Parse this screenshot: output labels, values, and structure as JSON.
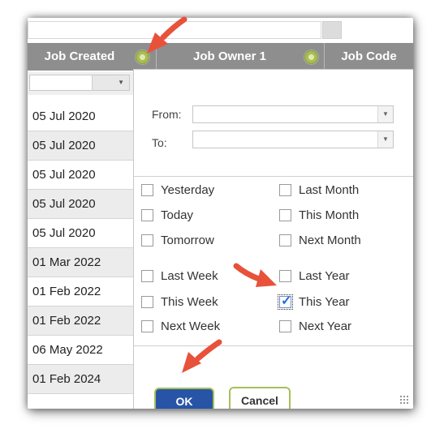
{
  "header": {
    "col_job_created": "Job Created",
    "col_job_owner": "Job Owner 1",
    "col_job_code": "Job Code"
  },
  "rows": [
    "05 Jul 2020",
    "05 Jul 2020",
    "05 Jul 2020",
    "05 Jul 2020",
    "05 Jul 2020",
    "01 Mar 2022",
    "01 Feb 2022",
    "01 Feb 2022",
    "06 May 2022",
    "01 Feb 2024"
  ],
  "filter": {
    "from_label": "From:",
    "to_label": "To:",
    "options_left": [
      "Yesterday",
      "Today",
      "Tomorrow",
      "Last Week",
      "This Week",
      "Next Week"
    ],
    "options_right": [
      "Last Month",
      "This Month",
      "Next Month",
      "Last Year",
      "This Year",
      "Next Year"
    ],
    "checked": "This Year",
    "ok_label": "OK",
    "cancel_label": "Cancel"
  },
  "colors": {
    "header_bg": "#8e8e8e",
    "ok_bg": "#2854a8",
    "button_border": "#a7bf5a",
    "arrow": "#e8523a",
    "check": "#1f6fd6"
  },
  "icons": [
    "gear-icon",
    "dropdown-arrow-icon",
    "checkmark-icon",
    "resize-grip-icon",
    "pointer-arrow-icon"
  ]
}
